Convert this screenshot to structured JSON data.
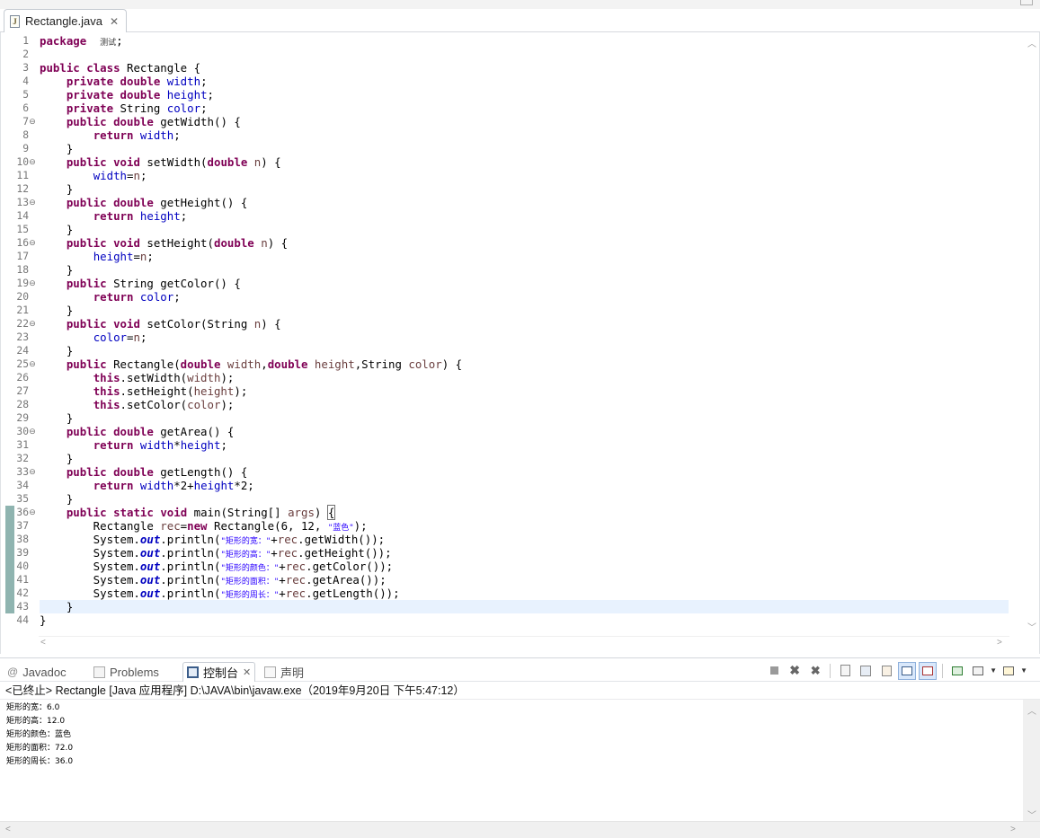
{
  "editor": {
    "tab_title": "Rectangle.java",
    "tab_icon": "java-file-icon",
    "close_icon": "close-icon",
    "fold_lines": [
      7,
      10,
      13,
      16,
      19,
      22,
      25,
      30,
      33,
      36
    ],
    "diff_lines": [
      36,
      37,
      38,
      39,
      40,
      41,
      42,
      43
    ],
    "current_line": 43,
    "lines": [
      "1",
      "2",
      "3",
      "4",
      "5",
      "6",
      "7",
      "8",
      "9",
      "10",
      "11",
      "12",
      "13",
      "14",
      "15",
      "16",
      "17",
      "18",
      "19",
      "20",
      "21",
      "22",
      "23",
      "24",
      "25",
      "26",
      "27",
      "28",
      "29",
      "30",
      "31",
      "32",
      "33",
      "34",
      "35",
      "36",
      "37",
      "38",
      "39",
      "40",
      "41",
      "42",
      "43",
      "44"
    ],
    "code": [
      [
        [
          "kw",
          "package"
        ],
        [
          "",
          "  "
        ],
        [
          "cjk",
          "测试"
        ],
        [
          "",
          ";"
        ]
      ],
      [],
      [
        [
          "kw",
          "public"
        ],
        [
          "",
          " "
        ],
        [
          "kw",
          "class"
        ],
        [
          "",
          " Rectangle {"
        ]
      ],
      [
        [
          "",
          "    "
        ],
        [
          "kw",
          "private"
        ],
        [
          "",
          " "
        ],
        [
          "kw",
          "double"
        ],
        [
          "",
          " "
        ],
        [
          "fld",
          "width"
        ],
        [
          "",
          ";"
        ]
      ],
      [
        [
          "",
          "    "
        ],
        [
          "kw",
          "private"
        ],
        [
          "",
          " "
        ],
        [
          "kw",
          "double"
        ],
        [
          "",
          " "
        ],
        [
          "fld",
          "height"
        ],
        [
          "",
          ";"
        ]
      ],
      [
        [
          "",
          "    "
        ],
        [
          "kw",
          "private"
        ],
        [
          "",
          " String "
        ],
        [
          "fld",
          "color"
        ],
        [
          "",
          ";"
        ]
      ],
      [
        [
          "",
          "    "
        ],
        [
          "kw",
          "public"
        ],
        [
          "",
          " "
        ],
        [
          "kw",
          "double"
        ],
        [
          "",
          " getWidth() {"
        ]
      ],
      [
        [
          "",
          "        "
        ],
        [
          "kw",
          "return"
        ],
        [
          "",
          " "
        ],
        [
          "fld",
          "width"
        ],
        [
          "",
          ";"
        ]
      ],
      [
        [
          "",
          "    }"
        ]
      ],
      [
        [
          "",
          "    "
        ],
        [
          "kw",
          "public"
        ],
        [
          "",
          " "
        ],
        [
          "kw",
          "void"
        ],
        [
          "",
          " setWidth("
        ],
        [
          "kw",
          "double"
        ],
        [
          "",
          " "
        ],
        [
          "prm",
          "n"
        ],
        [
          "",
          ") {"
        ]
      ],
      [
        [
          "",
          "        "
        ],
        [
          "fld",
          "width"
        ],
        [
          "",
          "="
        ],
        [
          "prm",
          "n"
        ],
        [
          "",
          ";"
        ]
      ],
      [
        [
          "",
          "    }"
        ]
      ],
      [
        [
          "",
          "    "
        ],
        [
          "kw",
          "public"
        ],
        [
          "",
          " "
        ],
        [
          "kw",
          "double"
        ],
        [
          "",
          " getHeight() {"
        ]
      ],
      [
        [
          "",
          "        "
        ],
        [
          "kw",
          "return"
        ],
        [
          "",
          " "
        ],
        [
          "fld",
          "height"
        ],
        [
          "",
          ";"
        ]
      ],
      [
        [
          "",
          "    }"
        ]
      ],
      [
        [
          "",
          "    "
        ],
        [
          "kw",
          "public"
        ],
        [
          "",
          " "
        ],
        [
          "kw",
          "void"
        ],
        [
          "",
          " setHeight("
        ],
        [
          "kw",
          "double"
        ],
        [
          "",
          " "
        ],
        [
          "prm",
          "n"
        ],
        [
          "",
          ") {"
        ]
      ],
      [
        [
          "",
          "        "
        ],
        [
          "fld",
          "height"
        ],
        [
          "",
          "="
        ],
        [
          "prm",
          "n"
        ],
        [
          "",
          ";"
        ]
      ],
      [
        [
          "",
          "    }"
        ]
      ],
      [
        [
          "",
          "    "
        ],
        [
          "kw",
          "public"
        ],
        [
          "",
          " String getColor() {"
        ]
      ],
      [
        [
          "",
          "        "
        ],
        [
          "kw",
          "return"
        ],
        [
          "",
          " "
        ],
        [
          "fld",
          "color"
        ],
        [
          "",
          ";"
        ]
      ],
      [
        [
          "",
          "    }"
        ]
      ],
      [
        [
          "",
          "    "
        ],
        [
          "kw",
          "public"
        ],
        [
          "",
          " "
        ],
        [
          "kw",
          "void"
        ],
        [
          "",
          " setColor(String "
        ],
        [
          "prm",
          "n"
        ],
        [
          "",
          ") {"
        ]
      ],
      [
        [
          "",
          "        "
        ],
        [
          "fld",
          "color"
        ],
        [
          "",
          "="
        ],
        [
          "prm",
          "n"
        ],
        [
          "",
          ";"
        ]
      ],
      [
        [
          "",
          "    }"
        ]
      ],
      [
        [
          "",
          "    "
        ],
        [
          "kw",
          "public"
        ],
        [
          "",
          " Rectangle("
        ],
        [
          "kw",
          "double"
        ],
        [
          "",
          " "
        ],
        [
          "prm",
          "width"
        ],
        [
          "",
          ","
        ],
        [
          "kw",
          "double"
        ],
        [
          "",
          " "
        ],
        [
          "prm",
          "height"
        ],
        [
          "",
          ",String "
        ],
        [
          "prm",
          "color"
        ],
        [
          "",
          ") {"
        ]
      ],
      [
        [
          "",
          "        "
        ],
        [
          "kw",
          "this"
        ],
        [
          "",
          ".setWidth("
        ],
        [
          "prm",
          "width"
        ],
        [
          "",
          ");"
        ]
      ],
      [
        [
          "",
          "        "
        ],
        [
          "kw",
          "this"
        ],
        [
          "",
          ".setHeight("
        ],
        [
          "prm",
          "height"
        ],
        [
          "",
          ");"
        ]
      ],
      [
        [
          "",
          "        "
        ],
        [
          "kw",
          "this"
        ],
        [
          "",
          ".setColor("
        ],
        [
          "prm",
          "color"
        ],
        [
          "",
          ");"
        ]
      ],
      [
        [
          "",
          "    }"
        ]
      ],
      [
        [
          "",
          "    "
        ],
        [
          "kw",
          "public"
        ],
        [
          "",
          " "
        ],
        [
          "kw",
          "double"
        ],
        [
          "",
          " getArea() {"
        ]
      ],
      [
        [
          "",
          "        "
        ],
        [
          "kw",
          "return"
        ],
        [
          "",
          " "
        ],
        [
          "fld",
          "width"
        ],
        [
          "",
          "*"
        ],
        [
          "fld",
          "height"
        ],
        [
          "",
          ";"
        ]
      ],
      [
        [
          "",
          "    }"
        ]
      ],
      [
        [
          "",
          "    "
        ],
        [
          "kw",
          "public"
        ],
        [
          "",
          " "
        ],
        [
          "kw",
          "double"
        ],
        [
          "",
          " getLength() {"
        ]
      ],
      [
        [
          "",
          "        "
        ],
        [
          "kw",
          "return"
        ],
        [
          "",
          " "
        ],
        [
          "fld",
          "width"
        ],
        [
          "",
          "*2+"
        ],
        [
          "fld",
          "height"
        ],
        [
          "",
          "*2;"
        ]
      ],
      [
        [
          "",
          "    }"
        ]
      ],
      [
        [
          "",
          "    "
        ],
        [
          "kw",
          "public"
        ],
        [
          "",
          " "
        ],
        [
          "kw",
          "static"
        ],
        [
          "",
          " "
        ],
        [
          "kw",
          "void"
        ],
        [
          "",
          " main(String[] "
        ],
        [
          "prm",
          "args"
        ],
        [
          "",
          ") "
        ],
        [
          "bracket",
          "{"
        ]
      ],
      [
        [
          "",
          "        Rectangle "
        ],
        [
          "prm",
          "rec"
        ],
        [
          "",
          "="
        ],
        [
          "kw",
          "new"
        ],
        [
          "",
          " Rectangle(6, 12, "
        ],
        [
          "str",
          "\"蓝色\""
        ],
        [
          "",
          ");"
        ]
      ],
      [
        [
          "",
          "        System."
        ],
        [
          "stf",
          "out"
        ],
        [
          "",
          ".println("
        ],
        [
          "str",
          "\"矩形的宽：\""
        ],
        [
          "",
          "+"
        ],
        [
          "prm",
          "rec"
        ],
        [
          "",
          ".getWidth());"
        ]
      ],
      [
        [
          "",
          "        System."
        ],
        [
          "stf",
          "out"
        ],
        [
          "",
          ".println("
        ],
        [
          "str",
          "\"矩形的高：\""
        ],
        [
          "",
          "+"
        ],
        [
          "prm",
          "rec"
        ],
        [
          "",
          ".getHeight());"
        ]
      ],
      [
        [
          "",
          "        System."
        ],
        [
          "stf",
          "out"
        ],
        [
          "",
          ".println("
        ],
        [
          "str",
          "\"矩形的颜色：\""
        ],
        [
          "",
          "+"
        ],
        [
          "prm",
          "rec"
        ],
        [
          "",
          ".getColor());"
        ]
      ],
      [
        [
          "",
          "        System."
        ],
        [
          "stf",
          "out"
        ],
        [
          "",
          ".println("
        ],
        [
          "str",
          "\"矩形的面积：\""
        ],
        [
          "",
          "+"
        ],
        [
          "prm",
          "rec"
        ],
        [
          "",
          ".getArea());"
        ]
      ],
      [
        [
          "",
          "        System."
        ],
        [
          "stf",
          "out"
        ],
        [
          "",
          ".println("
        ],
        [
          "str",
          "\"矩形的周长：\""
        ],
        [
          "",
          "+"
        ],
        [
          "prm",
          "rec"
        ],
        [
          "",
          ".getLength());"
        ]
      ],
      [
        [
          "",
          "    }"
        ]
      ],
      [
        [
          "",
          "}"
        ]
      ]
    ]
  },
  "panel": {
    "tabs": [
      {
        "label": "Javadoc",
        "icon": "javadoc-icon"
      },
      {
        "label": "Problems",
        "icon": "problems-icon"
      },
      {
        "label": "控制台",
        "icon": "console-icon",
        "active": true
      },
      {
        "label": "声明",
        "icon": "declaration-icon"
      }
    ],
    "toolbar_icons": [
      "terminate-icon",
      "remove-launch-icon",
      "remove-all-terminated-icon",
      "clear-console-icon",
      "scroll-lock-icon",
      "word-wrap-icon",
      "show-on-stdout-icon",
      "show-on-stderr-icon",
      "pin-console-icon",
      "display-selected-console-icon",
      "open-console-icon"
    ]
  },
  "console": {
    "title": "<已终止> Rectangle [Java 应用程序] D:\\JAVA\\bin\\javaw.exe（2019年9月20日 下午5:47:12）",
    "output": [
      "矩形的宽：6.0",
      "矩形的高：12.0",
      "矩形的颜色：蓝色",
      "矩形的面积：72.0",
      "矩形的周长：36.0"
    ]
  },
  "colors": {
    "keyword": "#7f0055",
    "field": "#0000c0",
    "parameter": "#6a3e3e",
    "string": "#2a00ff",
    "current_line": "#e8f2fe",
    "diff_marker": "#8fb4b0"
  }
}
